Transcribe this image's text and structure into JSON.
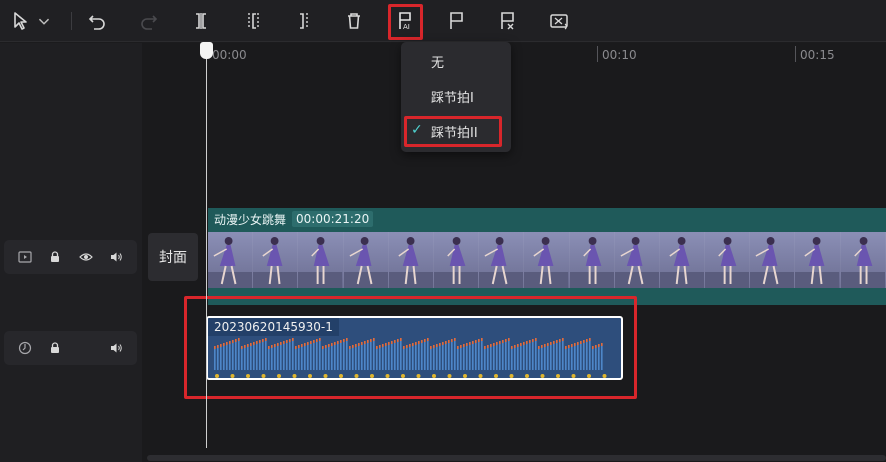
{
  "toolbar": {
    "items": [
      {
        "name": "select-tool-icon"
      },
      {
        "name": "chevron-down-icon"
      },
      {
        "name": "undo-icon"
      },
      {
        "name": "redo-icon"
      },
      {
        "name": "split-icon"
      },
      {
        "name": "split-left-icon"
      },
      {
        "name": "split-right-icon"
      },
      {
        "name": "delete-icon"
      },
      {
        "name": "auto-beat-icon"
      },
      {
        "name": "add-marker-icon"
      },
      {
        "name": "remove-marker-icon"
      },
      {
        "name": "audio-separate-icon"
      }
    ]
  },
  "ruler": {
    "labels": [
      "00:00",
      "00:10",
      "00:15"
    ]
  },
  "beat_menu": {
    "options": [
      {
        "label": "无",
        "selected": false
      },
      {
        "label": "踩节拍I",
        "selected": false
      },
      {
        "label": "踩节拍II",
        "selected": true
      }
    ],
    "check_glyph": "✓"
  },
  "video_track": {
    "clip_name": "动漫少女跳舞",
    "duration": "00:00:21:20"
  },
  "cover": {
    "label": "封面"
  },
  "audio_track": {
    "clip_name": "20230620145930-1"
  },
  "colors": {
    "highlight": "#d8262b",
    "video_track": "#1f5a5a",
    "audio_clip": "#2e4e7c",
    "beat_dot": "#e0b52f",
    "wave_top": "#e26a3a",
    "check": "#4fd2cf"
  }
}
